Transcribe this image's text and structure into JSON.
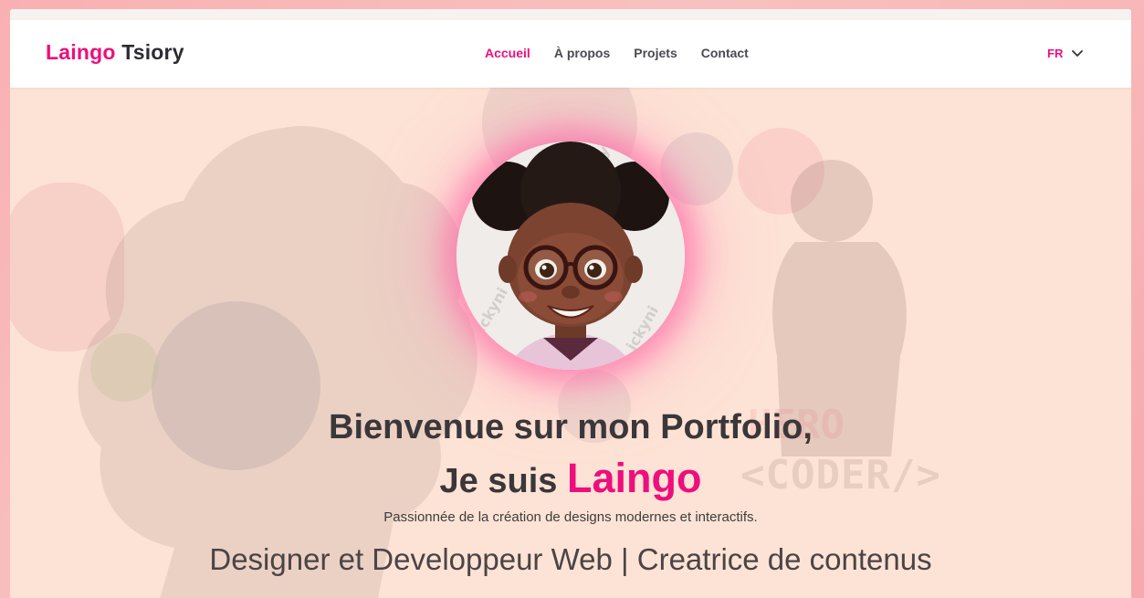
{
  "nav": {
    "brand_first": "Laingo",
    "brand_last": "Tsiory",
    "links": [
      {
        "label": "Accueil",
        "active": true
      },
      {
        "label": "À propos",
        "active": false
      },
      {
        "label": "Projets",
        "active": false
      },
      {
        "label": "Contact",
        "active": false
      }
    ],
    "language": "FR",
    "language_icon": "chevron-down-icon"
  },
  "hero": {
    "greeting": "Bienvenue sur mon Portfolio,",
    "intro_prefix": "Je suis",
    "name": "Laingo",
    "tagline": "Passionnée de la création de designs modernes et interactifs.",
    "roles": "Designer et Developpeur Web | Creatrice de contenus",
    "background_text": "<CODER/>",
    "background_text_2": "HERO",
    "avatar_watermark": "ickyni"
  },
  "colors": {
    "accent": "#ee0e7d",
    "hero_bg": "#fde3d5",
    "text": "#3b3739"
  }
}
